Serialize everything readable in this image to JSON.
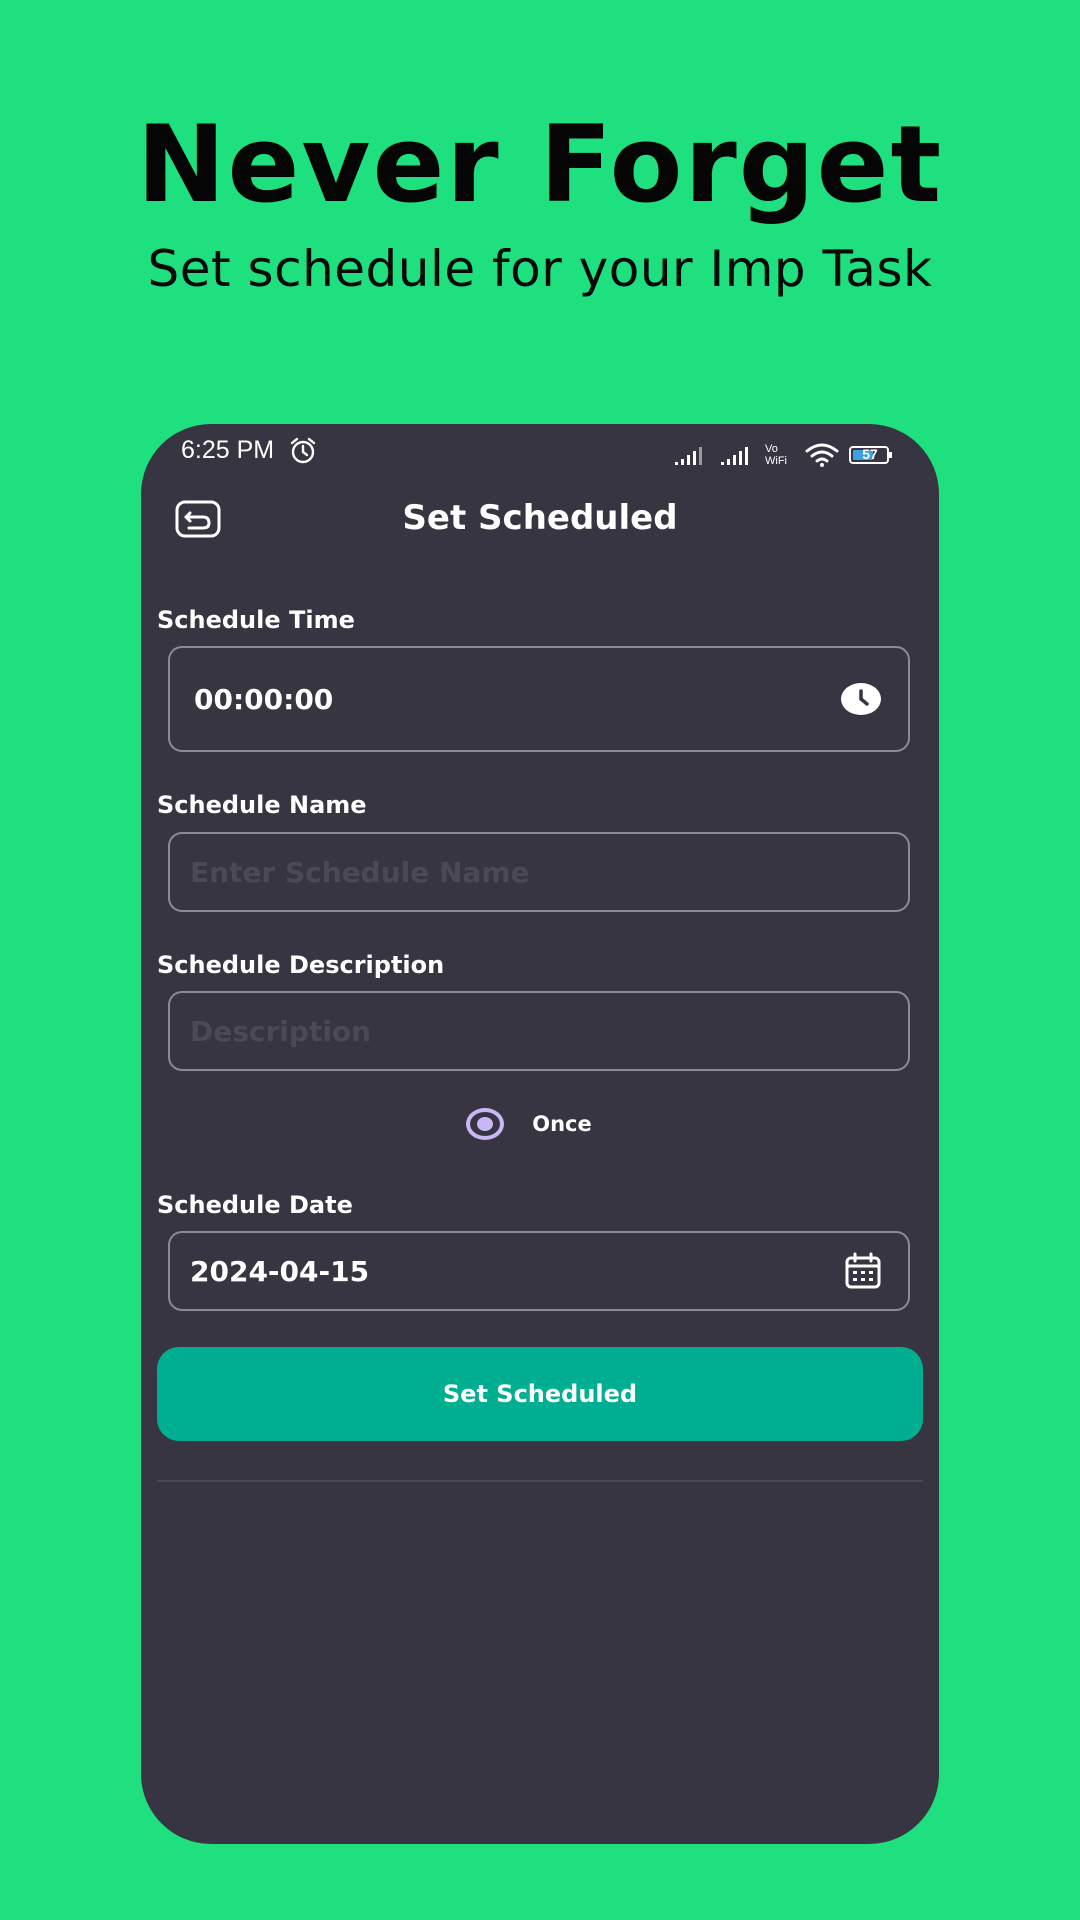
{
  "hero": {
    "title": "Never Forget",
    "subtitle": "Set schedule for your Imp Task"
  },
  "status_bar": {
    "time": "6:25 PM",
    "network_label_top": "Vo",
    "network_label_bottom": "WiFi",
    "battery_level": "57",
    "icons": [
      "alarm-icon",
      "signal-icon",
      "signal-icon",
      "wifi-icon",
      "battery-icon"
    ]
  },
  "header": {
    "title": "Set Scheduled",
    "back_icon": "back-icon"
  },
  "form": {
    "time_label": "Schedule Time",
    "time_value": "00:00:00",
    "name_label": "Schedule Name",
    "name_placeholder": "Enter Schedule Name",
    "description_label": "Schedule Description",
    "description_placeholder": "Description",
    "repeat_option": "Once",
    "date_label": "Schedule Date",
    "date_value": "2024-04-15",
    "submit_label": "Set Scheduled"
  },
  "colors": {
    "background": "#1ee07f",
    "card": "#363541",
    "accent": "#00af91",
    "radio": "#c9b8f5"
  }
}
